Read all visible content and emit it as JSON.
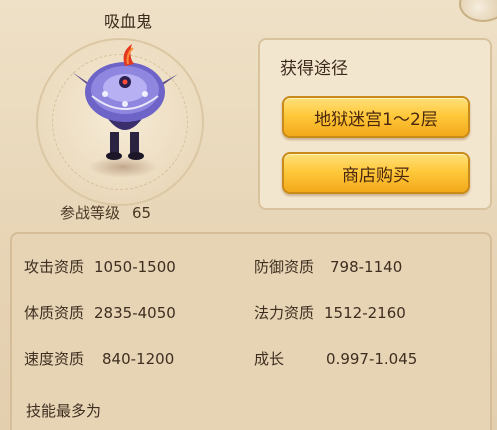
{
  "pet": {
    "name": "吸血鬼",
    "battle_level_label": "参战等级",
    "battle_level_value": "65"
  },
  "acquire": {
    "title": "获得途径",
    "buttons": [
      {
        "label": "地狱迷宫1～2层"
      },
      {
        "label": "商店购买"
      }
    ]
  },
  "stats": [
    {
      "label": "攻击资质",
      "value": "1050-1500"
    },
    {
      "label": "防御资质",
      "value": "798-1140"
    },
    {
      "label": "体质资质",
      "value": "2835-4050"
    },
    {
      "label": "法力资质",
      "value": "1512-2160"
    },
    {
      "label": "速度资质",
      "value": "840-1200"
    },
    {
      "label": "成长",
      "value": "0.997-1.045"
    }
  ],
  "skills_label": "技能最多为",
  "colors": {
    "button_gold": "#ffc93c",
    "panel_bg": "#efe1c7",
    "text_dark": "#3b2a1c"
  }
}
